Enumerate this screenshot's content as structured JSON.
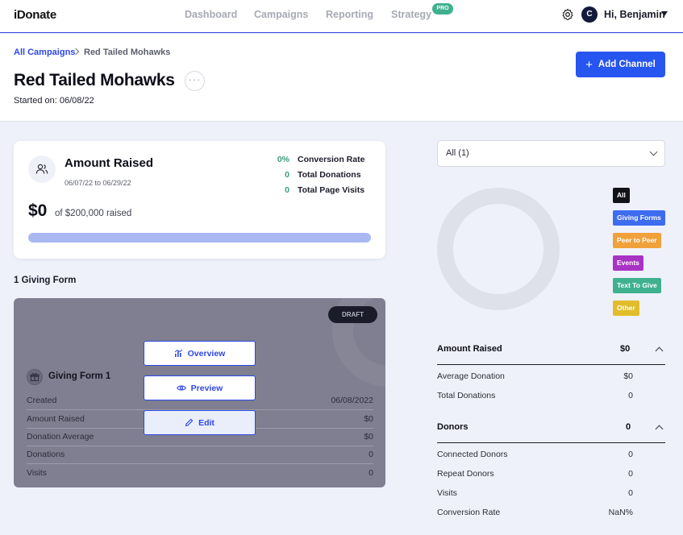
{
  "nav": {
    "logo": "iDonate",
    "links": [
      "Dashboard",
      "Campaigns",
      "Reporting",
      "Strategy"
    ],
    "pro_badge": "PRO",
    "avatar_initial": "C",
    "greeting": "Hi, Benjamin"
  },
  "header": {
    "breadcrumb_link": "All Campaigns",
    "breadcrumb_current": "Red Tailed Mohawks",
    "title": "Red Tailed Mohawks",
    "more": "···",
    "started": "Started on: 06/08/22",
    "add_channel": "Add Channel",
    "add_icon": "+"
  },
  "summary_card": {
    "title": "Amount Raised",
    "dates": "06/07/22 to 06/29/22",
    "stats": [
      {
        "value": "0%",
        "label": "Conversion Rate"
      },
      {
        "value": "0",
        "label": "Total Donations"
      },
      {
        "value": "0",
        "label": "Total Page Visits"
      }
    ],
    "raised": "$0",
    "raised_of": "of $200,000 raised",
    "progress_fraction": 0
  },
  "forms_heading": "1 Giving Form",
  "giving_form": {
    "status": "DRAFT",
    "title": "Giving Form 1",
    "rows": [
      {
        "label": "Created",
        "value": "06/08/2022"
      },
      {
        "label": "Amount Raised",
        "value": "$0"
      },
      {
        "label": "Donation Average",
        "value": "$0"
      },
      {
        "label": "Donations",
        "value": "0"
      },
      {
        "label": "Visits",
        "value": "0"
      }
    ],
    "buttons": {
      "overview": "Overview",
      "preview": "Preview",
      "edit": "Edit"
    }
  },
  "right_panel": {
    "filter_value": "All (1)",
    "legend": [
      {
        "label": "All",
        "color": "#111318"
      },
      {
        "label": "Giving Forms",
        "color": "#3d6cf0"
      },
      {
        "label": "Peer to Peer",
        "color": "#f0a13a"
      },
      {
        "label": "Events",
        "color": "#a933c4"
      },
      {
        "label": "Text To Give",
        "color": "#3fb18e"
      },
      {
        "label": "Other",
        "color": "#e2bd2b"
      }
    ],
    "amount_section": {
      "title": "Amount Raised",
      "value": "$0",
      "rows": [
        {
          "label": "Average Donation",
          "value": "$0"
        },
        {
          "label": "Total Donations",
          "value": "0"
        }
      ]
    },
    "donors_section": {
      "title": "Donors",
      "value": "0",
      "rows": [
        {
          "label": "Connected Donors",
          "value": "0"
        },
        {
          "label": "Repeat Donors",
          "value": "0"
        },
        {
          "label": "Visits",
          "value": "0"
        },
        {
          "label": "Conversion Rate",
          "value": "NaN%"
        }
      ]
    }
  }
}
